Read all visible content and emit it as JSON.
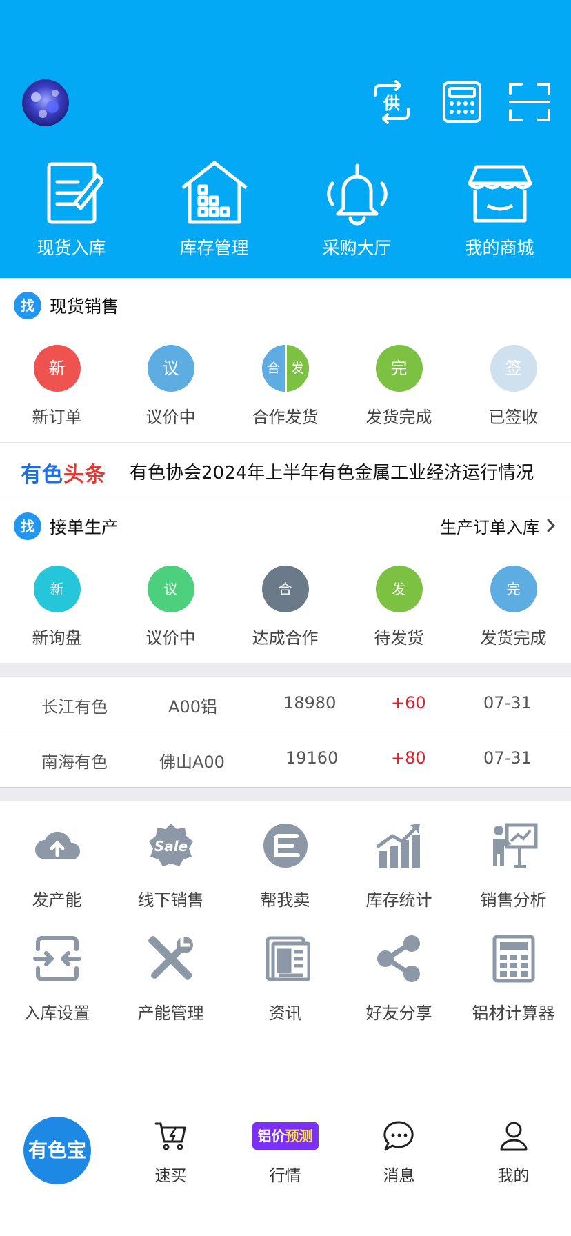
{
  "colors": {
    "header_bg": "#03a9f4",
    "accent_blue": "#2196f3",
    "positive_red": "#e0202a",
    "gap_bg": "#ebebf0",
    "tool_icon": "#8c98a6"
  },
  "header": {
    "top_icons": [
      "supply-switch-icon",
      "calculator-icon",
      "scan-icon"
    ],
    "quick_actions": [
      {
        "label": "现货入库",
        "icon": "edit-document-icon"
      },
      {
        "label": "库存管理",
        "icon": "warehouse-icon"
      },
      {
        "label": "采购大厅",
        "icon": "bell-icon"
      },
      {
        "label": "我的商城",
        "icon": "store-icon"
      }
    ]
  },
  "spot_sales": {
    "badge": "找",
    "title": "现货销售",
    "statuses": [
      {
        "char": "新",
        "label": "新订单",
        "color": "#ef5350"
      },
      {
        "char": "议",
        "label": "议价中",
        "color": "#5dade2"
      },
      {
        "char_left": "合",
        "char_right": "发",
        "label": "合作发货",
        "color_left": "#5dade2",
        "color_right": "#7cc142"
      },
      {
        "char": "完",
        "label": "发货完成",
        "color": "#7cc142"
      },
      {
        "char": "签",
        "label": "已签收",
        "color": "#cfe0ee"
      }
    ]
  },
  "news": {
    "logo_part1": "有色",
    "logo_part2": "头条",
    "text": "有色协会2024年上半年有色金属工业经济运行情况"
  },
  "production": {
    "badge": "找",
    "title": "接单生产",
    "link": "生产订单入库",
    "statuses": [
      {
        "char": "新",
        "label": "新询盘",
        "color": "#26c6da"
      },
      {
        "char": "议",
        "label": "议价中",
        "color": "#4cd07d"
      },
      {
        "char": "合",
        "label": "达成合作",
        "color": "#6b7a88"
      },
      {
        "char": "发",
        "label": "待发货",
        "color": "#7cc142"
      },
      {
        "char": "完",
        "label": "发货完成",
        "color": "#5dade2"
      }
    ]
  },
  "prices": [
    {
      "market": "长江有色",
      "product": "A00铝",
      "price": "18980",
      "change": "+60",
      "date": "07-31"
    },
    {
      "market": "南海有色",
      "product": "佛山A00",
      "price": "19160",
      "change": "+80",
      "date": "07-31"
    }
  ],
  "tools": [
    {
      "label": "发产能",
      "icon": "cloud-upload-icon"
    },
    {
      "label": "线下销售",
      "icon": "sale-badge-icon"
    },
    {
      "label": "帮我卖",
      "icon": "help-sell-icon"
    },
    {
      "label": "库存统计",
      "icon": "bar-chart-icon"
    },
    {
      "label": "销售分析",
      "icon": "presentation-icon"
    },
    {
      "label": "入库设置",
      "icon": "merge-arrows-icon"
    },
    {
      "label": "产能管理",
      "icon": "tools-icon"
    },
    {
      "label": "资讯",
      "icon": "newspaper-icon"
    },
    {
      "label": "好友分享",
      "icon": "share-icon"
    },
    {
      "label": "铝材计算器",
      "icon": "calculator-icon"
    }
  ],
  "tabbar": {
    "home": "有色宝",
    "tabs": [
      {
        "label": "速买",
        "icon": "quick-buy-cart-icon"
      },
      {
        "label": "行情",
        "icon": "price-forecast-icon",
        "badge_part1": "铝价",
        "badge_part2": "预测"
      },
      {
        "label": "消息",
        "icon": "message-icon"
      },
      {
        "label": "我的",
        "icon": "user-icon"
      }
    ]
  }
}
